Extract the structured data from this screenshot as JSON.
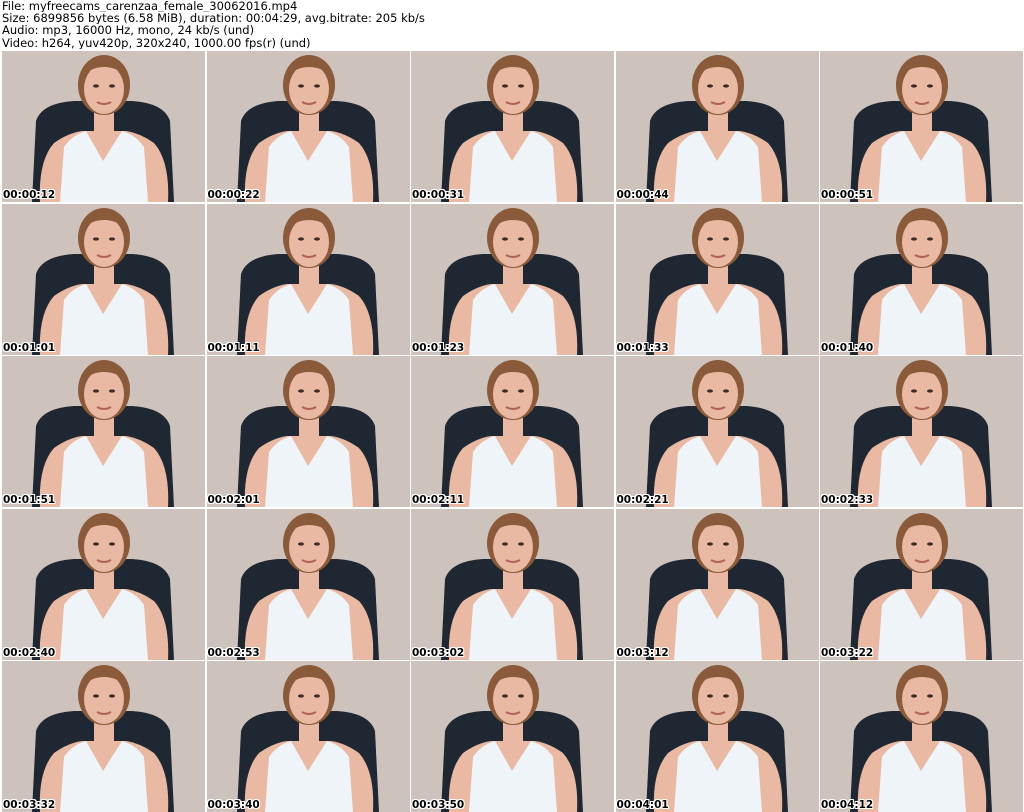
{
  "header": {
    "file": "File: myfreecams_carenzaa_female_30062016.mp4",
    "size": "Size: 6899856 bytes (6.58 MiB), duration: 00:04:29, avg.bitrate: 205 kb/s",
    "audio": "Audio: mp3, 16000 Hz, mono, 24 kb/s (und)",
    "video": "Video: h264, yuv420p, 320x240, 1000.00 fps(r) (und)"
  },
  "colors": {
    "wall": "#cdc3bc",
    "chair": "#1f2733",
    "top": "#eef4f7",
    "skin": "#e9b9a3",
    "hair": "#8a5a3a"
  },
  "thumbnails": [
    {
      "timestamp": "00:00:12"
    },
    {
      "timestamp": "00:00:22"
    },
    {
      "timestamp": "00:00:31"
    },
    {
      "timestamp": "00:00:44"
    },
    {
      "timestamp": "00:00:51"
    },
    {
      "timestamp": "00:01:01"
    },
    {
      "timestamp": "00:01:11"
    },
    {
      "timestamp": "00:01:23"
    },
    {
      "timestamp": "00:01:33"
    },
    {
      "timestamp": "00:01:40"
    },
    {
      "timestamp": "00:01:51"
    },
    {
      "timestamp": "00:02:01"
    },
    {
      "timestamp": "00:02:11"
    },
    {
      "timestamp": "00:02:21"
    },
    {
      "timestamp": "00:02:33"
    },
    {
      "timestamp": "00:02:40"
    },
    {
      "timestamp": "00:02:53"
    },
    {
      "timestamp": "00:03:02"
    },
    {
      "timestamp": "00:03:12"
    },
    {
      "timestamp": "00:03:22"
    },
    {
      "timestamp": "00:03:32"
    },
    {
      "timestamp": "00:03:40"
    },
    {
      "timestamp": "00:03:50"
    },
    {
      "timestamp": "00:04:01"
    },
    {
      "timestamp": "00:04:12"
    }
  ]
}
